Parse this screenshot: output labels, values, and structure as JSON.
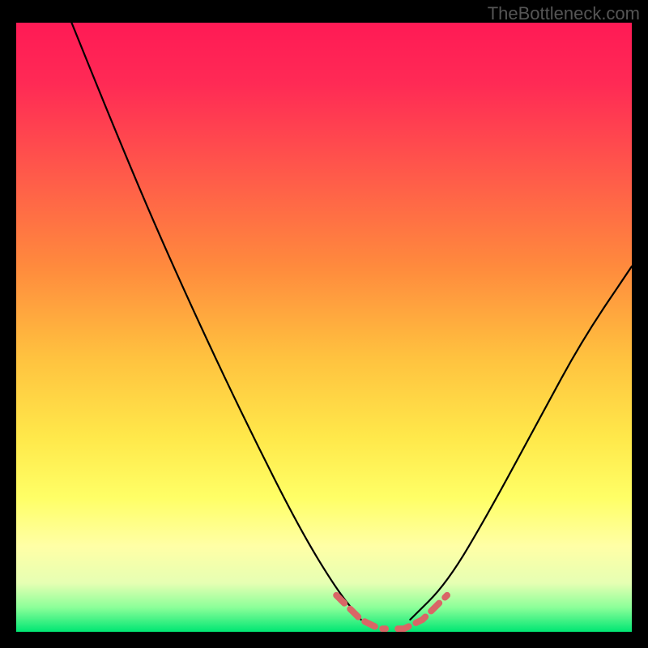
{
  "watermark": "TheBottleneck.com",
  "chart_data": {
    "type": "line",
    "title": "",
    "xlabel": "",
    "ylabel": "",
    "xlim": [
      0,
      100
    ],
    "ylim": [
      0,
      100
    ],
    "background_gradient": {
      "top_region": [
        "#ff1a4d",
        "#ff3355"
      ],
      "mid_region": [
        "#ff8a3d",
        "#ffd64a",
        "#ffff66"
      ],
      "bottom_region": [
        "#ffffb3",
        "#33ff77",
        "#00e673"
      ]
    },
    "series": [
      {
        "name": "main-curve-left",
        "color": "#000000",
        "x": [
          9,
          15,
          22,
          30,
          38,
          46,
          52,
          56
        ],
        "y": [
          100,
          85,
          68,
          50,
          33,
          17,
          7,
          2
        ]
      },
      {
        "name": "main-curve-right",
        "color": "#000000",
        "x": [
          64,
          70,
          77,
          85,
          92,
          100
        ],
        "y": [
          2,
          8,
          20,
          35,
          48,
          60
        ]
      },
      {
        "name": "bottom-dashed-left",
        "color": "#e06666",
        "style": "dashed",
        "x": [
          52,
          54,
          56,
          58,
          59,
          60
        ],
        "y": [
          6,
          4,
          2,
          1,
          0.5,
          0.5
        ]
      },
      {
        "name": "bottom-dashed-right",
        "color": "#e06666",
        "style": "dashed",
        "x": [
          62,
          63,
          64,
          66,
          68,
          70
        ],
        "y": [
          0.5,
          0.5,
          1,
          2,
          4,
          6
        ]
      }
    ]
  }
}
